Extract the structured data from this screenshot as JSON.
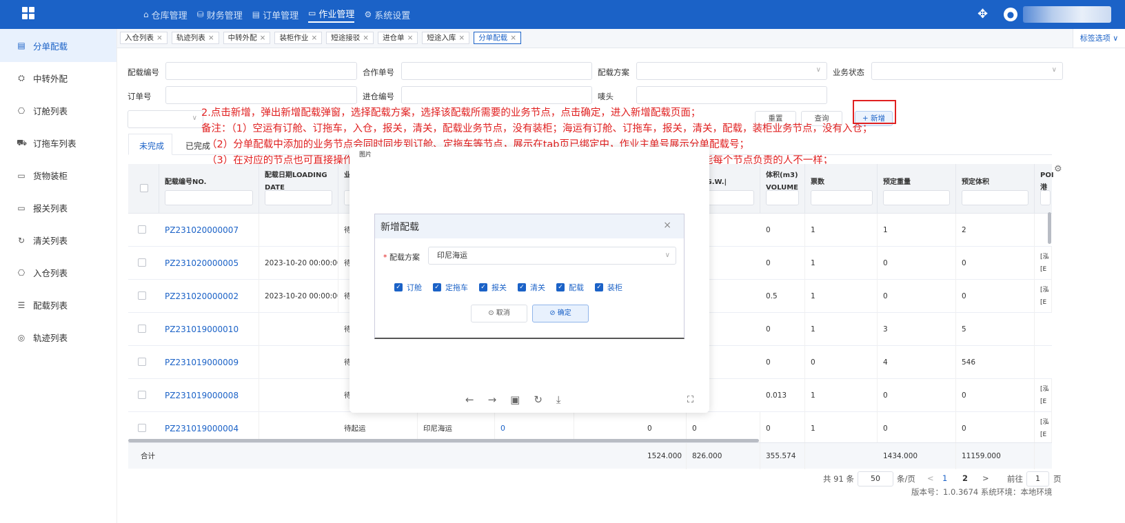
{
  "topnav": {
    "items": [
      {
        "icon": "⌂",
        "label": "仓库管理"
      },
      {
        "icon": "⛁",
        "label": "财务管理"
      },
      {
        "icon": "▤",
        "label": "订单管理"
      },
      {
        "icon": "▭",
        "label": "作业管理"
      },
      {
        "icon": "⚙",
        "label": "系统设置"
      }
    ]
  },
  "sidebar": {
    "items": [
      {
        "icon": "▤",
        "label": "分单配载"
      },
      {
        "icon": "⛭",
        "label": "中转外配"
      },
      {
        "icon": "⎔",
        "label": "订舱列表"
      },
      {
        "icon": "⛟",
        "label": "订拖车列表"
      },
      {
        "icon": "▭",
        "label": "货物装柜"
      },
      {
        "icon": "▭",
        "label": "报关列表"
      },
      {
        "icon": "↻",
        "label": "清关列表"
      },
      {
        "icon": "⎔",
        "label": "入仓列表"
      },
      {
        "icon": "☰",
        "label": "配载列表"
      },
      {
        "icon": "◎",
        "label": "轨迹列表"
      }
    ]
  },
  "tabs": [
    {
      "label": "入仓列表",
      "close": "×"
    },
    {
      "label": "轨迹列表",
      "close": "×"
    },
    {
      "label": "中转外配",
      "close": "×"
    },
    {
      "label": "装柜作业",
      "close": "×"
    },
    {
      "label": "短途接驳",
      "close": "×"
    },
    {
      "label": "进仓单",
      "close": "×"
    },
    {
      "label": "短途入库",
      "close": "×"
    },
    {
      "label": "分单配载",
      "close": "×"
    }
  ],
  "tab_options": "标签选项 ∨",
  "form": {
    "load_no": "配载编号",
    "coop_no": "合作单号",
    "plan": "配载方案",
    "biz_status": "业务状态",
    "order_no": "订单号",
    "warehouse_no": "进仓编号",
    "mark": "唛头",
    "reset": "重置",
    "query": "查询",
    "new": "+ 新增"
  },
  "annotation": {
    "line1": "2.点击新增，弹出新增配载弹窗，选择配载方案，选择该配载所需要的业务节点，点击确定，进入新增配载页面；",
    "line2": "备注：（1）空运有订舱、订拖车，入仓，报关，清关，配载业务节点，没有装柜；海运有订舱、订拖车，报关，清关，配载，装柜业务节点，没有入仓；",
    "line3": "（2）分单配载中添加的业务节点会同时同步到订舱、定拖车等节点，展示在tab页已绑定中，作业主单号展示分单配载号；",
    "line4": "（3）在对应的节点也可直接操作对应节点的新增，然后再绑定到作业主单里，此设置是考虑到部门分工不同，可能每个节点负责的人不一样；"
  },
  "subtabs": {
    "incomplete": "未完成",
    "complete": "已完成"
  },
  "table": {
    "headers": [
      {
        "label": "配载编号NO."
      },
      {
        "label": "配载日期LOADING DATE"
      },
      {
        "label": "业 e"
      },
      {
        "label": ""
      },
      {
        "label": ""
      },
      {
        "label": ""
      },
      {
        "label": ""
      },
      {
        "label": "KG)G.W.|"
      },
      {
        "label": "体积(m3)VOLUME"
      },
      {
        "label": "票数"
      },
      {
        "label": "预定重量"
      },
      {
        "label": "预定体积"
      },
      {
        "label": "POI 港"
      }
    ],
    "rows": [
      {
        "no": "PZ231020000007",
        "date": "",
        "status": "待",
        "plan": "",
        "c5": "",
        "gw": "",
        "vol": "0",
        "tickets": "1",
        "weight": "1",
        "volume": "2",
        "port": ""
      },
      {
        "no": "PZ231020000005",
        "date": "2023-10-20 00:00:00",
        "status": "待",
        "plan": "",
        "c5": "",
        "gw": "",
        "vol": "0",
        "tickets": "1",
        "weight": "0",
        "volume": "0",
        "port": "[泓 [E"
      },
      {
        "no": "PZ231020000002",
        "date": "2023-10-20 00:00:00",
        "status": "待",
        "plan": "",
        "c5": "",
        "gw": "",
        "vol": "0.5",
        "tickets": "1",
        "weight": "0",
        "volume": "0",
        "port": "[泓 [E"
      },
      {
        "no": "PZ231019000010",
        "date": "",
        "status": "待",
        "plan": "",
        "c5": "",
        "gw": "",
        "vol": "0",
        "tickets": "1",
        "weight": "3",
        "volume": "5",
        "port": ""
      },
      {
        "no": "PZ231019000009",
        "date": "",
        "status": "待",
        "plan": "",
        "c5": "",
        "gw": "",
        "vol": "0",
        "tickets": "0",
        "weight": "4",
        "volume": "546",
        "port": ""
      },
      {
        "no": "PZ231019000008",
        "date": "",
        "status": "待",
        "plan": "",
        "c5": "",
        "gw": "",
        "vol": "0.013",
        "tickets": "1",
        "weight": "0",
        "volume": "0",
        "port": "[泓 [E"
      },
      {
        "no": "PZ231019000004",
        "date": "",
        "status": "待起运",
        "plan": "印尼海运",
        "c5": "0",
        "a": "0",
        "gw": "0",
        "vol": "0",
        "tickets": "1",
        "weight": "0",
        "volume": "0",
        "port": "[泓 [E"
      }
    ],
    "footer": {
      "label": "合计",
      "a": "1524.000",
      "gw": "826.000",
      "vol": "355.574",
      "weight": "1434.000",
      "volume": "11159.000"
    }
  },
  "viewer": {
    "title": "图片"
  },
  "dialog": {
    "title": "新增配载",
    "close": "×",
    "plan_label": "配载方案",
    "plan_value": "印尼海运",
    "checks": [
      "订舱",
      "定拖车",
      "报关",
      "清关",
      "配载",
      "装柜"
    ],
    "cancel": "⊙ 取消",
    "ok": "⊘ 确定"
  },
  "pagination": {
    "total": "共 91 条",
    "page_size": "50",
    "per_page": "条/页",
    "prev": "<",
    "page1": "1",
    "page2": "2",
    "next": ">",
    "goto": "前往",
    "goto_value": "1",
    "page_unit": "页"
  },
  "version": "版本号：1.0.3674 系统环境：本地环境"
}
